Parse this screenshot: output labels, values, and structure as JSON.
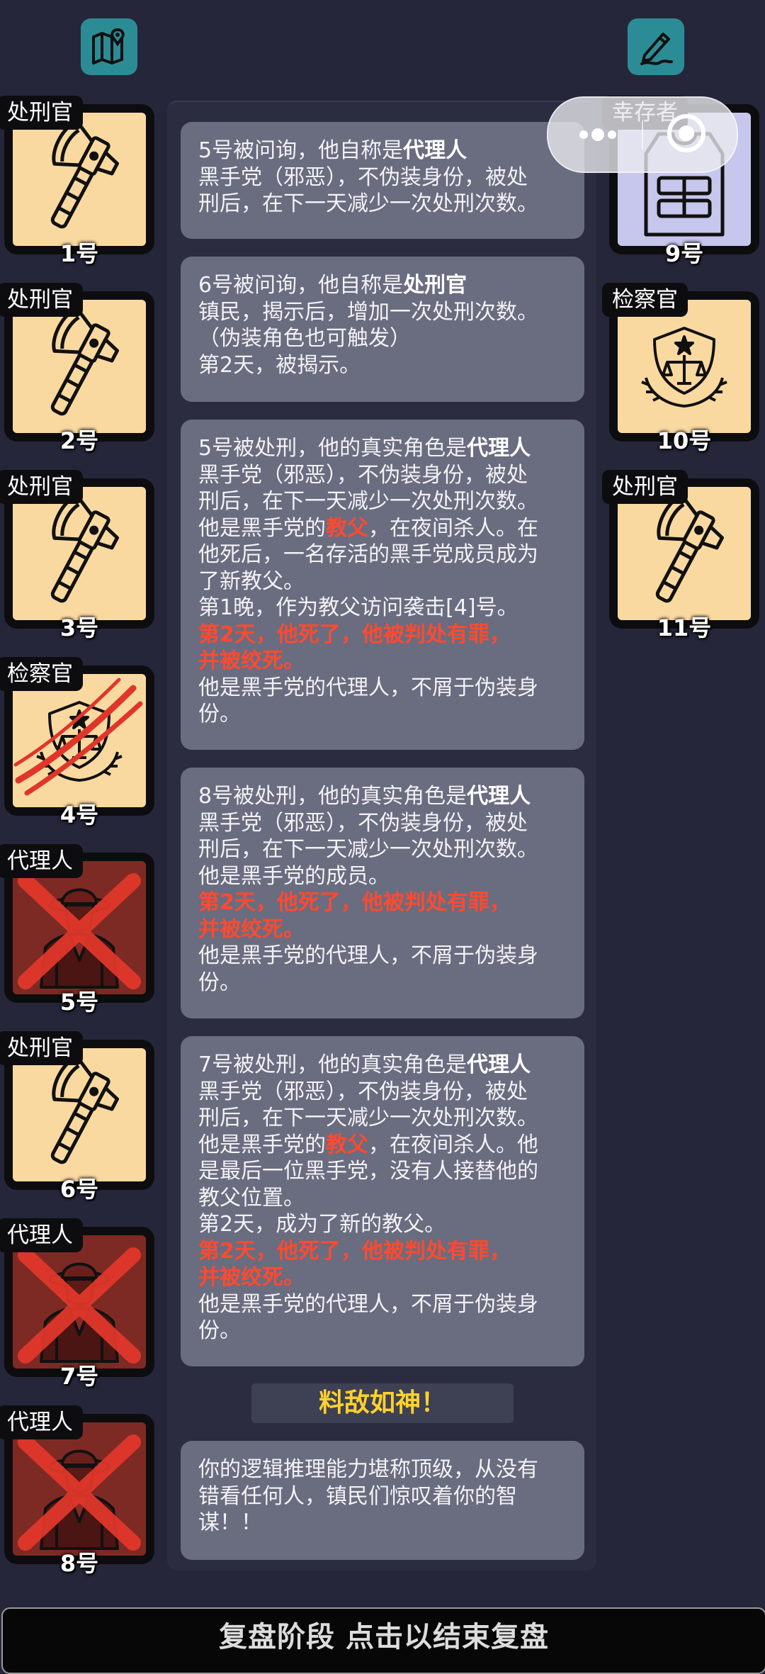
{
  "left_players": [
    {
      "role": "处刑官",
      "number": "1号",
      "state": "alive",
      "icon": "axe-icon"
    },
    {
      "role": "处刑官",
      "number": "2号",
      "state": "alive",
      "icon": "axe-icon"
    },
    {
      "role": "处刑官",
      "number": "3号",
      "state": "alive",
      "icon": "axe-icon"
    },
    {
      "role": "检察官",
      "number": "4号",
      "state": "attacked",
      "icon": "justice-badge-icon"
    },
    {
      "role": "代理人",
      "number": "5号",
      "state": "dead",
      "icon": "mobster-icon"
    },
    {
      "role": "处刑官",
      "number": "6号",
      "state": "alive",
      "icon": "axe-icon"
    },
    {
      "role": "代理人",
      "number": "7号",
      "state": "dead",
      "icon": "mobster-icon"
    },
    {
      "role": "代理人",
      "number": "8号",
      "state": "dead",
      "icon": "mobster-icon"
    }
  ],
  "right_players": [
    {
      "role": "幸存者",
      "number": "9号",
      "state": "alive",
      "icon": "vest-icon"
    },
    {
      "role": "检察官",
      "number": "10号",
      "state": "alive",
      "icon": "justice-badge-icon"
    },
    {
      "role": "处刑官",
      "number": "11号",
      "state": "alive",
      "icon": "axe-icon"
    }
  ],
  "messages": [
    {
      "lines": [
        [
          "5号被问询，他自称是",
          {
            "b": "代理人"
          }
        ],
        [
          "黑手党（邪恶），不伪装身份，被处"
        ],
        [
          "刑后，在下一天减少一次处刑次数。"
        ]
      ]
    },
    {
      "lines": [
        [
          "6号被问询，他自称是",
          {
            "b": "处刑官"
          }
        ],
        [
          "镇民，揭示后，增加一次处刑次数。"
        ],
        [
          "（伪装角色也可触发）"
        ],
        [
          "第2天，被揭示。"
        ]
      ]
    },
    {
      "lines": [
        [
          "5号被处刑，他的真实角色是",
          {
            "b": "代理人"
          }
        ],
        [
          "黑手党（邪恶），不伪装身份，被处"
        ],
        [
          "刑后，在下一天减少一次处刑次数。"
        ],
        [
          "他是黑手党的",
          {
            "r": "教父"
          },
          "，在夜间杀人。在"
        ],
        [
          "他死后，一名存活的黑手党成员成为"
        ],
        [
          "了新教父。"
        ],
        [
          "第1晚，作为教父访问袭击[4]号。"
        ],
        [
          {
            "r": "第2天，他死了，他被判处有罪，"
          }
        ],
        [
          {
            "r": "并被绞死。"
          }
        ],
        [
          "他是黑手党的代理人，不屑于伪装身"
        ],
        [
          "份。"
        ]
      ]
    },
    {
      "lines": [
        [
          "8号被处刑，他的真实角色是",
          {
            "b": "代理人"
          }
        ],
        [
          "黑手党（邪恶），不伪装身份，被处"
        ],
        [
          "刑后，在下一天减少一次处刑次数。"
        ],
        [
          "他是黑手党的成员。"
        ],
        [
          {
            "r": "第2天，他死了，他被判处有罪，"
          }
        ],
        [
          {
            "r": "并被绞死。"
          }
        ],
        [
          "他是黑手党的代理人，不屑于伪装身"
        ],
        [
          "份。"
        ]
      ]
    },
    {
      "lines": [
        [
          "7号被处刑，他的真实角色是",
          {
            "b": "代理人"
          }
        ],
        [
          "黑手党（邪恶），不伪装身份，被处"
        ],
        [
          "刑后，在下一天减少一次处刑次数。"
        ],
        [
          "他是黑手党的",
          {
            "r": "教父"
          },
          "，在夜间杀人。他"
        ],
        [
          "是最后一位黑手党，没有人接替他的"
        ],
        [
          "教父位置。"
        ],
        [
          "第2天，成为了新的教父。"
        ],
        [
          {
            "r": "第2天，他死了，他被判处有罪，"
          }
        ],
        [
          {
            "r": "并被绞死。"
          }
        ],
        [
          "他是黑手党的代理人，不屑于伪装身"
        ],
        [
          "份。"
        ]
      ]
    }
  ],
  "result_banner": "料敌如神！",
  "result_message": {
    "lines": [
      [
        "你的逻辑推理能力堪称顶级，从没有"
      ],
      [
        "错看任何人，镇民们惊叹着你的智"
      ],
      [
        "谋！！"
      ]
    ]
  },
  "footer": "复盘阶段 点击以结束复盘",
  "icons": {
    "top_left": "map-pin-icon",
    "top_right": "pen-edit-icon",
    "capsule": [
      "more-dots-icon",
      "close-target-icon"
    ]
  },
  "colors": {
    "background": "#25263a",
    "card_alive": "#fad9a0",
    "card_dead": "#7e2a24",
    "highlight_red": "#ff4a30",
    "banner_gold": "#ffd12e",
    "icon_teal": "#2c8c96"
  }
}
